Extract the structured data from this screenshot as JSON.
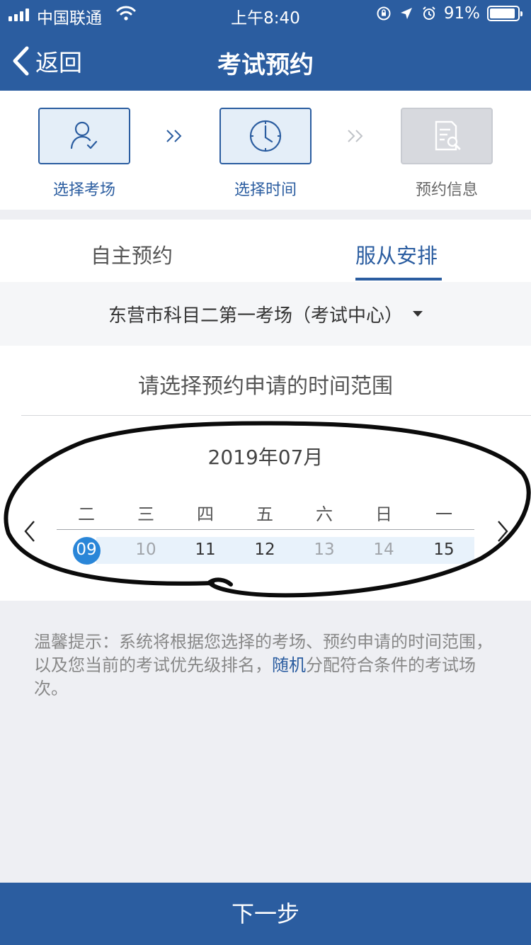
{
  "status_bar": {
    "carrier": "中国联通",
    "time": "上午8:40",
    "battery_text": "91%",
    "battery_level": 0.91,
    "icons": [
      "signal-icon",
      "wifi-icon",
      "orientation-lock-icon",
      "location-icon",
      "alarm-icon",
      "battery-icon"
    ]
  },
  "nav": {
    "back_label": "返回",
    "title": "考试预约"
  },
  "steps": [
    {
      "label": "选择考场",
      "icon": "user-check-icon",
      "state": "active"
    },
    {
      "label": "选择时间",
      "icon": "clock-icon",
      "state": "active"
    },
    {
      "label": "预约信息",
      "icon": "document-search-icon",
      "state": "inactive"
    }
  ],
  "tabs": {
    "self": "自主预约",
    "arranged": "服从安排",
    "active": "arranged"
  },
  "venue": {
    "name": "东营市科目二第一考场（考试中心）"
  },
  "calendar": {
    "prompt": "请选择预约申请的时间范围",
    "month": "2019年07月",
    "weekdays": [
      "二",
      "三",
      "四",
      "五",
      "六",
      "日",
      "一"
    ],
    "days": [
      "09",
      "10",
      "11",
      "12",
      "13",
      "14",
      "15"
    ],
    "selected_day": "09",
    "disabled_days": [
      "10",
      "13",
      "14"
    ]
  },
  "tip": {
    "prefix": "温馨提示：",
    "text_before": "系统将根据您选择的考场、预约申请的时间范围，以及您当前的考试优先级排名，",
    "highlight": "随机",
    "text_after": "分配符合条件的考试场次。"
  },
  "next_button": "下一步",
  "colors": {
    "primary": "#2b5da0",
    "selected_day": "#2a86d8",
    "range_highlight": "#e8f2fb"
  }
}
